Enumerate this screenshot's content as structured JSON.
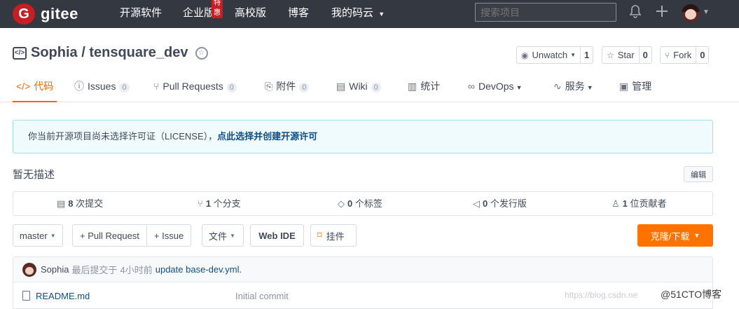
{
  "topbar": {
    "logo_mark": "G",
    "logo_text": "gitee",
    "nav": [
      "开源软件",
      "企业版",
      "高校版",
      "博客",
      "我的码云"
    ],
    "enterprise_badge": "特惠",
    "search_placeholder": "搜索项目",
    "icons": [
      "bell-icon",
      "plus-icon",
      "avatar",
      "chevron-down-icon"
    ]
  },
  "repo": {
    "title": "Sophia / tensquare_dev",
    "watch": {
      "label": "Unwatch",
      "count": "1"
    },
    "star": {
      "label": "Star",
      "count": "0"
    },
    "fork": {
      "label": "Fork",
      "count": "0"
    }
  },
  "tabs": [
    {
      "label": "代码",
      "icon": "code-icon",
      "active": true
    },
    {
      "label": "Issues",
      "count": "0",
      "icon": "issue-icon"
    },
    {
      "label": "Pull Requests",
      "count": "0",
      "icon": "pr-icon"
    },
    {
      "label": "附件",
      "count": "0",
      "icon": "attachment-icon"
    },
    {
      "label": "Wiki",
      "count": "0",
      "icon": "book-icon"
    },
    {
      "label": "统计",
      "icon": "chart-icon"
    },
    {
      "label": "DevOps",
      "icon": "infinity-icon"
    },
    {
      "label": "服务",
      "icon": "pulse-icon"
    },
    {
      "label": "管理",
      "icon": "settings-doc-icon"
    }
  ],
  "notice": {
    "text": "你当前开源项目尚未选择许可证（LICENSE），",
    "link": "点此选择并创建开源许可"
  },
  "description": "暂无描述",
  "edit_label": "编辑",
  "stats": [
    {
      "num": "8",
      "label": " 次提交"
    },
    {
      "num": "1",
      "label": " 个分支"
    },
    {
      "num": "0",
      "label": " 个标签"
    },
    {
      "num": "0",
      "label": " 个发行版"
    },
    {
      "num": "1",
      "label": " 位贡献者"
    }
  ],
  "toolbar": {
    "branch": "master",
    "pull_request": "+ Pull Request",
    "issue": "+ Issue",
    "file": "文件",
    "webide": "Web IDE",
    "bookmark": "挂件",
    "clone": "克隆/下载"
  },
  "commit": {
    "author": "Sophia",
    "prefix": "最后提交于",
    "time": "4小时前",
    "message": "update base-dev.yml."
  },
  "files": [
    {
      "name": "README.md",
      "message": "Initial commit"
    }
  ],
  "watermark": "https://blog.csdn.ne",
  "watermark2": "@51CTO博客",
  "colors": {
    "accent": "#f26800",
    "clone": "#fe7300",
    "topbar": "#333841",
    "brand": "#c71d23"
  }
}
